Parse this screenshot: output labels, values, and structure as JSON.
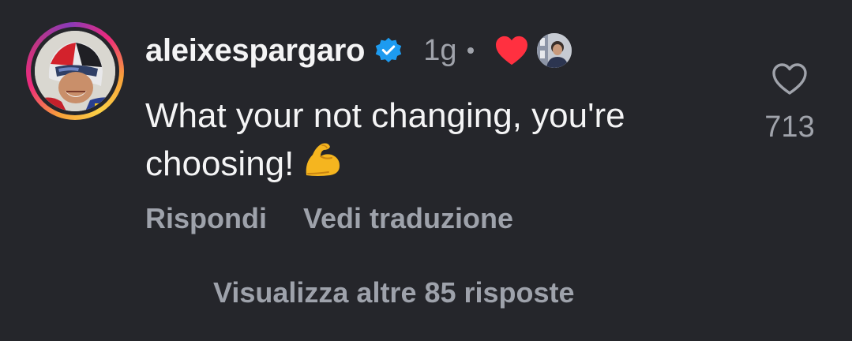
{
  "comment": {
    "username": "aleixespargaro",
    "time": "1g",
    "text_line1": "What your not changing, you're",
    "text_line2": "choosing!",
    "emoji": "flexed-biceps",
    "like_count": "713"
  },
  "actions": {
    "reply_label": "Rispondi",
    "translate_label": "Vedi traduzione"
  },
  "replies": {
    "view_more_label": "Visualizza altre 85 risposte"
  },
  "colors": {
    "background": "#25262b",
    "text_primary": "#f4f4f5",
    "text_secondary": "#a0a3ab",
    "verified_blue": "#1d9bf0",
    "heart_red": "#ff3040"
  }
}
